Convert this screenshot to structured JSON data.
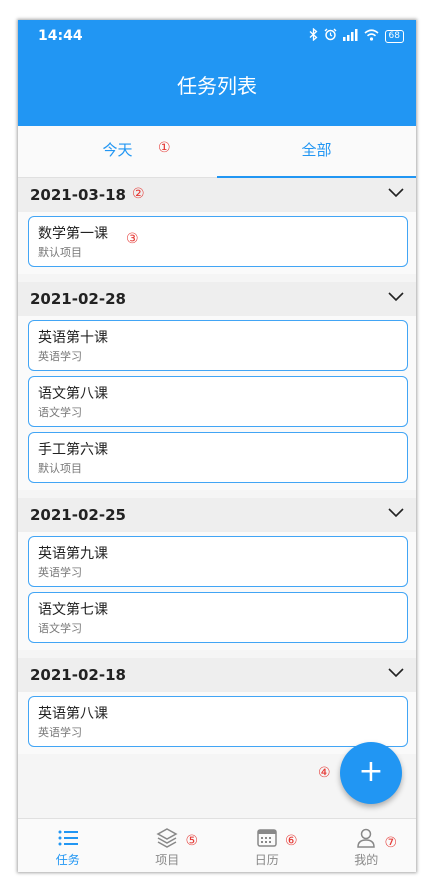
{
  "status_bar": {
    "time": "14:44",
    "battery": "68"
  },
  "header": {
    "title": "任务列表"
  },
  "tabs": [
    {
      "label": "今天",
      "annotation": "①"
    },
    {
      "label": "全部"
    }
  ],
  "groups": [
    {
      "date": "2021-03-18",
      "annotation": "②",
      "tasks": [
        {
          "title": "数学第一课",
          "project": "默认项目",
          "annotation": "③"
        }
      ]
    },
    {
      "date": "2021-02-28",
      "tasks": [
        {
          "title": "英语第十课",
          "project": "英语学习"
        },
        {
          "title": "语文第八课",
          "project": "语文学习"
        },
        {
          "title": "手工第六课",
          "project": "默认项目"
        }
      ]
    },
    {
      "date": "2021-02-25",
      "tasks": [
        {
          "title": "英语第九课",
          "project": "英语学习"
        },
        {
          "title": "语文第七课",
          "project": "语文学习"
        }
      ]
    },
    {
      "date": "2021-02-18",
      "tasks": [
        {
          "title": "英语第八课",
          "project": "英语学习"
        }
      ]
    }
  ],
  "fab": {
    "symbol": "+",
    "annotation": "④"
  },
  "bottom_nav": [
    {
      "label": "任务",
      "icon": "list-icon",
      "active": true
    },
    {
      "label": "项目",
      "icon": "layers-icon",
      "annotation": "⑤"
    },
    {
      "label": "日历",
      "icon": "calendar-icon",
      "annotation": "⑥"
    },
    {
      "label": "我的",
      "icon": "person-icon",
      "annotation": "⑦"
    }
  ],
  "colors": {
    "primary": "#2196F3",
    "annotation": "#e53935",
    "card_border": "#42A5F5"
  }
}
